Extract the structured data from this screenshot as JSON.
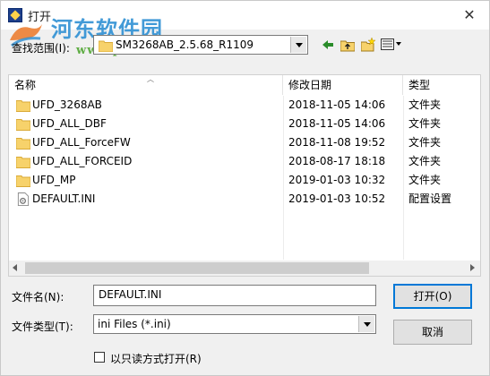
{
  "title": "打开",
  "watermark": {
    "site_name": "河东软件园",
    "url": "www.pc0359.cn"
  },
  "lookin": {
    "label": "查找范围(I):",
    "value": "SM3268AB_2.5.68_R1109"
  },
  "toolbar": [
    "back-icon",
    "up-folder-icon",
    "new-folder-icon",
    "view-menu-icon"
  ],
  "list": {
    "columns": [
      "名称",
      "修改日期",
      "类型"
    ],
    "rows": [
      {
        "name": "UFD_3268AB",
        "date": "2018-11-05 14:06",
        "type": "文件夹",
        "icon": "folder-icon"
      },
      {
        "name": "UFD_ALL_DBF",
        "date": "2018-11-05 14:06",
        "type": "文件夹",
        "icon": "folder-icon"
      },
      {
        "name": "UFD_ALL_ForceFW",
        "date": "2018-11-08 19:52",
        "type": "文件夹",
        "icon": "folder-icon"
      },
      {
        "name": "UFD_ALL_FORCEID",
        "date": "2018-08-17 18:18",
        "type": "文件夹",
        "icon": "folder-icon"
      },
      {
        "name": "UFD_MP",
        "date": "2019-01-03 10:32",
        "type": "文件夹",
        "icon": "folder-icon"
      },
      {
        "name": "DEFAULT.INI",
        "date": "2019-01-03 10:52",
        "type": "配置设置",
        "icon": "settings-file-icon"
      }
    ]
  },
  "filename": {
    "label": "文件名(N):",
    "value": "DEFAULT.INI"
  },
  "filetype": {
    "label": "文件类型(T):",
    "value": "ini Files (*.ini)"
  },
  "buttons": {
    "open": "打开(O)",
    "cancel": "取消"
  },
  "readonly": {
    "label": "以只读方式打开(R)",
    "checked": false
  },
  "colors": {
    "folder": "#f7d26b",
    "accent": "#0078d7"
  }
}
